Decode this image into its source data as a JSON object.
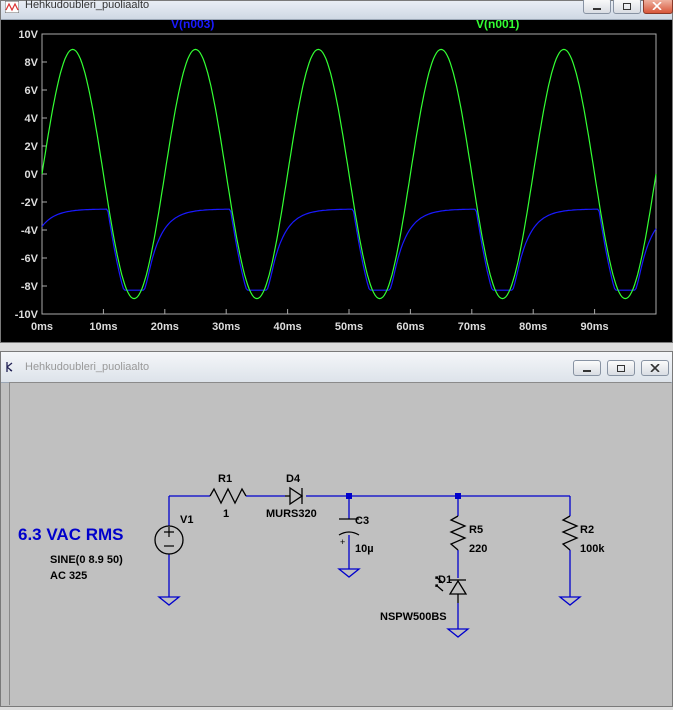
{
  "top_window": {
    "title": "Hehkudoubleri_puoliaalto",
    "icon": "waveform-window-icon"
  },
  "bottom_window": {
    "title": "Hehkudoubleri_puoliaalto",
    "icon": "schematic-window-icon"
  },
  "chart_data": {
    "type": "line",
    "x_unit": "ms",
    "xlim": [
      0,
      100
    ],
    "ylim": [
      -10,
      10
    ],
    "y_ticks": [
      "10V",
      "8V",
      "6V",
      "4V",
      "2V",
      "0V",
      "-2V",
      "-4V",
      "-6V",
      "-8V",
      "-10V"
    ],
    "x_ticks": [
      "0ms",
      "10ms",
      "20ms",
      "30ms",
      "40ms",
      "50ms",
      "60ms",
      "70ms",
      "80ms",
      "90ms"
    ],
    "grid": false,
    "series": [
      {
        "name": "V(n003)",
        "color": "#1a1aff",
        "description_values": {
          "baseline_min": -3.9,
          "peak": -2.5,
          "trough": -8.3
        }
      },
      {
        "name": "V(n001)",
        "color": "#33ff33",
        "amplitude": 8.9,
        "frequency_hz": 50
      }
    ]
  },
  "schematic": {
    "label_main": "6.3 VAC RMS",
    "v1_name": "V1",
    "v1_line1": "SINE(0 8.9 50)",
    "v1_line2": "AC 325",
    "r1_name": "R1",
    "r1_value": "1",
    "d4_name": "D4",
    "d4_value": "MURS320",
    "c3_name": "C3",
    "c3_value": "10µ",
    "r5_name": "R5",
    "r5_value": "220",
    "r2_name": "R2",
    "r2_value": "100k",
    "d1_name": "D1",
    "d1_value": "NSPW500BS",
    "wire_color": "#0000cc",
    "text_color": "#000000",
    "label_color": "#0000cc"
  }
}
